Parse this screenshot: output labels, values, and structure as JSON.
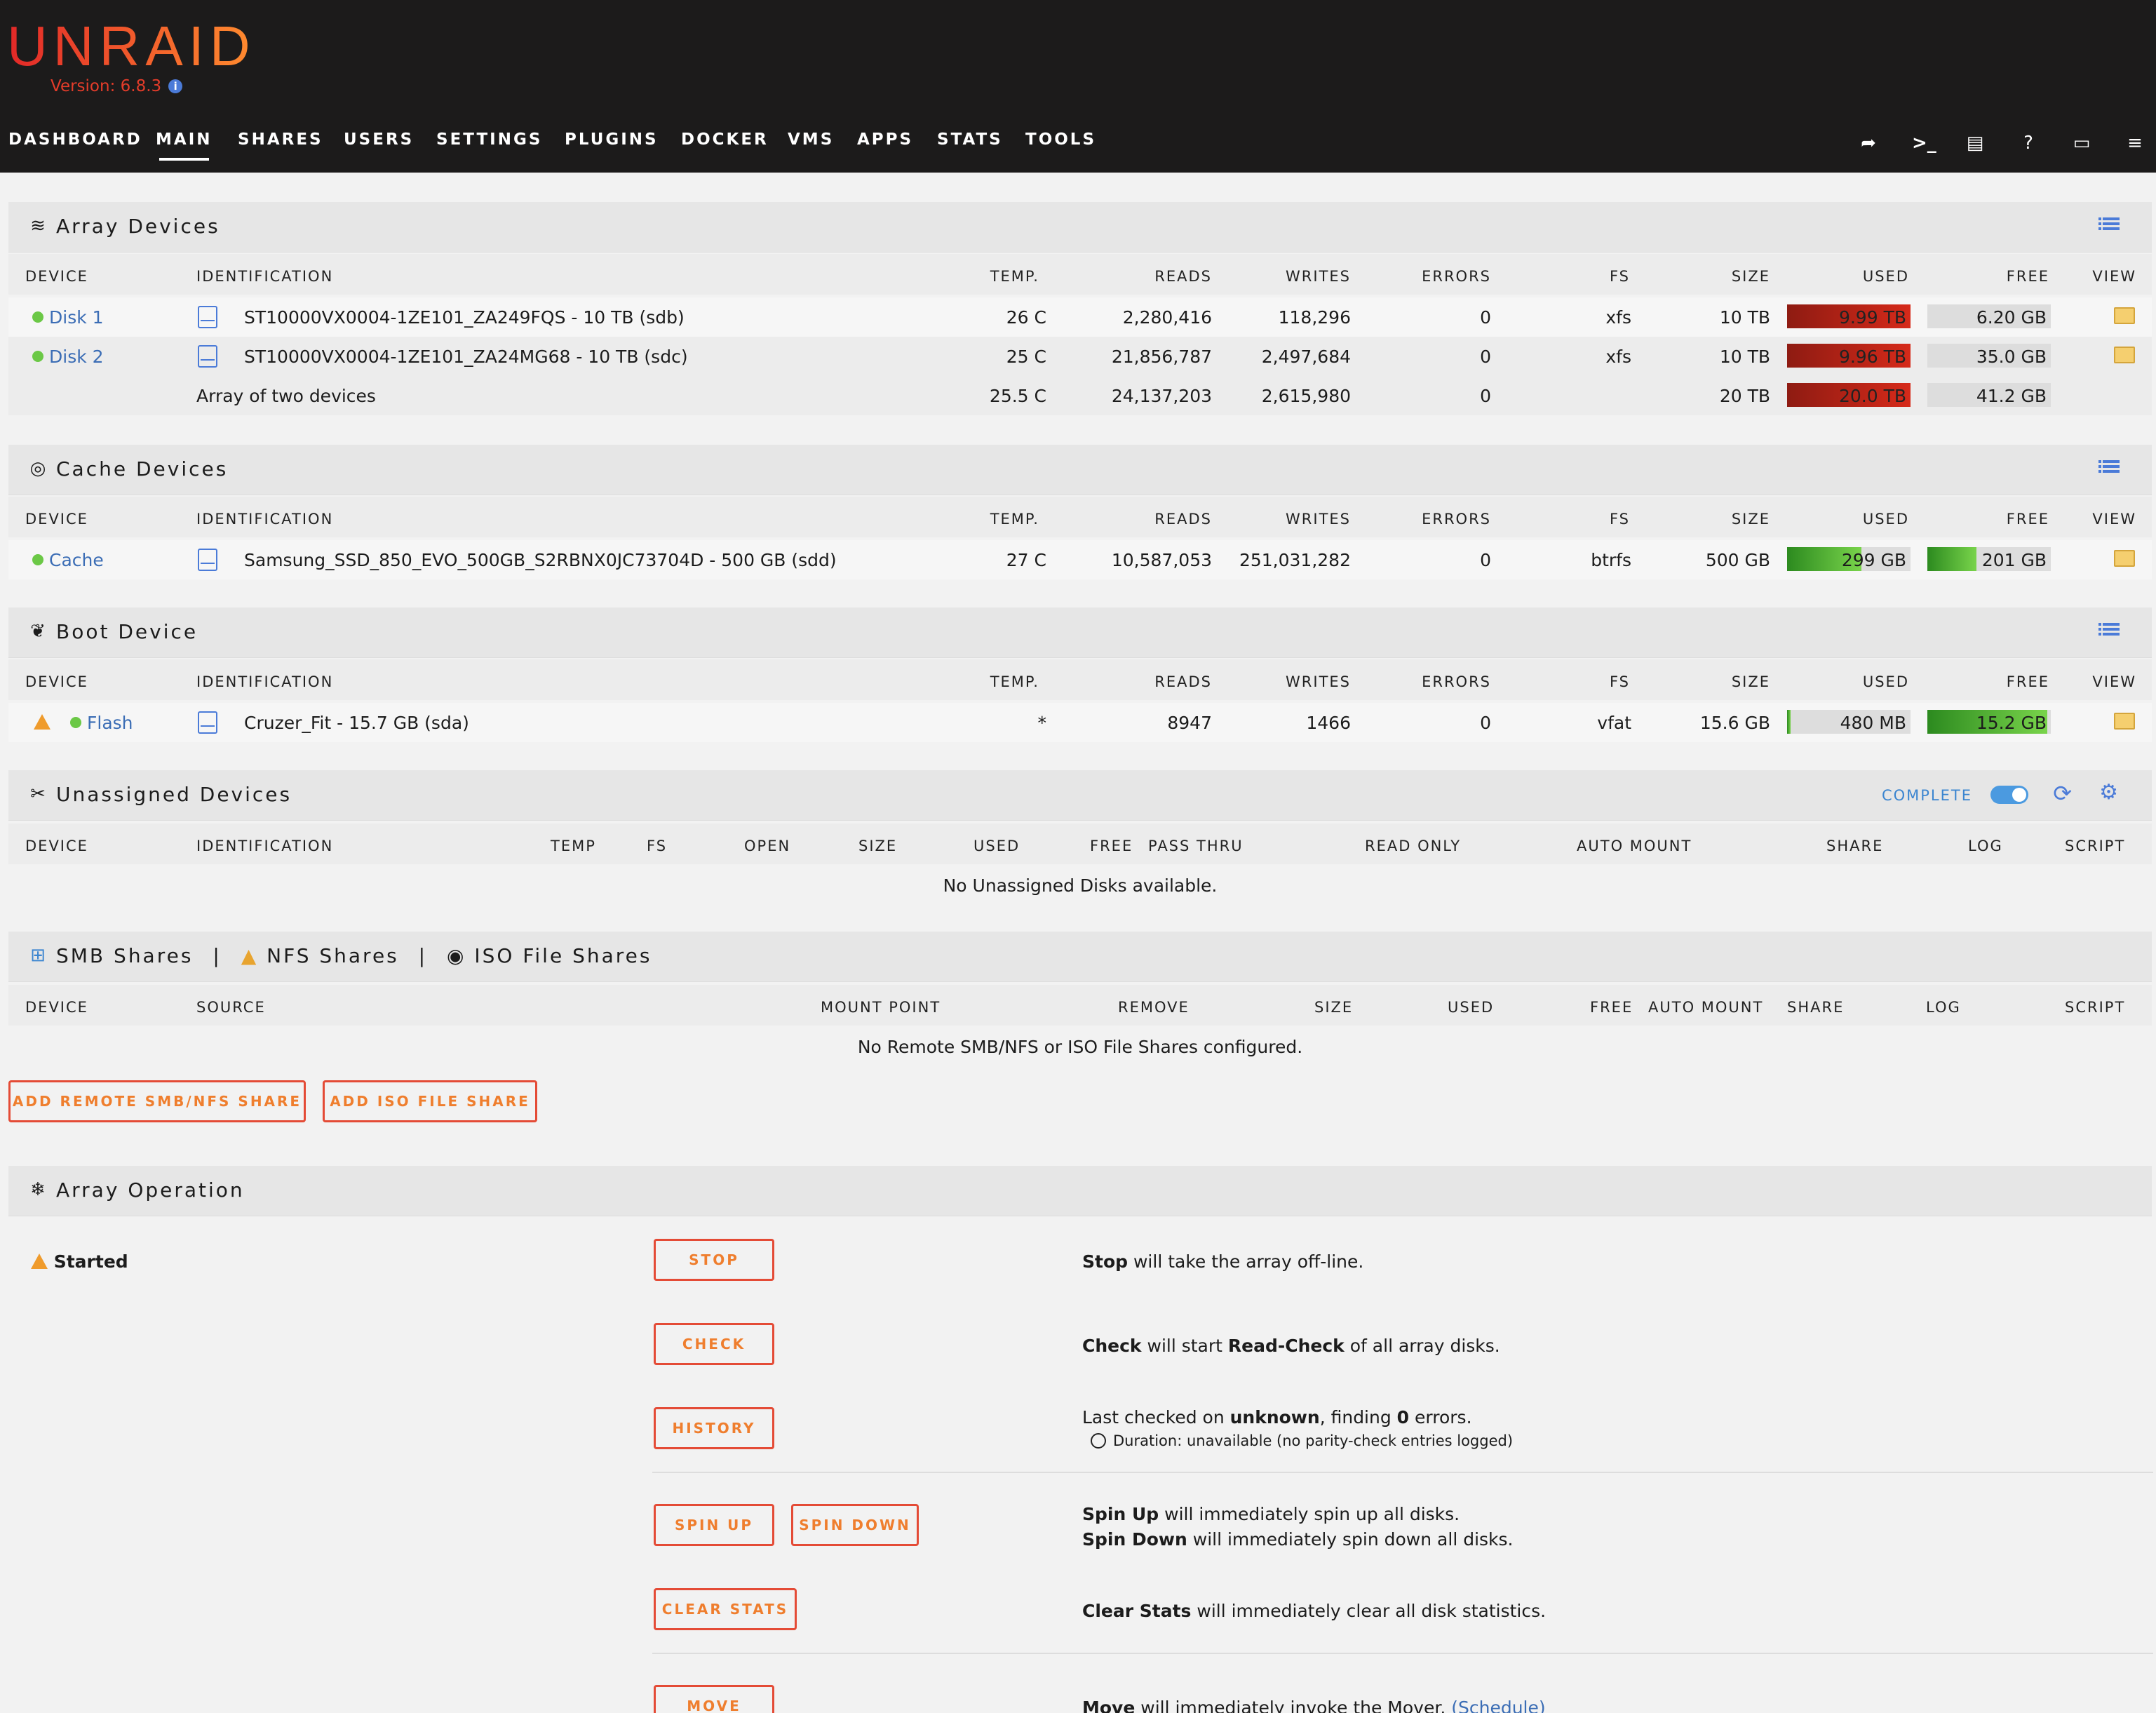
{
  "app": {
    "logo": "UNRAID",
    "version": "Version: 6.8.3"
  },
  "nav": [
    "DASHBOARD",
    "MAIN",
    "SHARES",
    "USERS",
    "SETTINGS",
    "PLUGINS",
    "DOCKER",
    "VMS",
    "APPS",
    "STATS",
    "TOOLS"
  ],
  "nav_active": "MAIN",
  "header_icons": [
    "logout-icon",
    "terminal-icon",
    "feedback-icon",
    "help-icon",
    "monitor-icon",
    "log-icon"
  ],
  "colors": {
    "header_bg": "#1c1b1b",
    "accent": "#ef7e2e",
    "link": "#3b6db5",
    "used_red": "#d62a1a",
    "free_green": "#6bc846"
  },
  "disk_columns": [
    "DEVICE",
    "IDENTIFICATION",
    "TEMP.",
    "READS",
    "WRITES",
    "ERRORS",
    "FS",
    "SIZE",
    "USED",
    "FREE",
    "VIEW"
  ],
  "array": {
    "title": "Array Devices",
    "rows": [
      {
        "device": "Disk 1",
        "id": "ST10000VX0004-1ZE101_ZA249FQS - 10 TB (sdb)",
        "temp": "26 C",
        "reads": "2,280,416",
        "writes": "118,296",
        "errors": "0",
        "fs": "xfs",
        "size": "10 TB",
        "used": "9.99 TB",
        "used_frac": 0.999,
        "free": "6.20 GB",
        "free_frac": 0.0
      },
      {
        "device": "Disk 2",
        "id": "ST10000VX0004-1ZE101_ZA24MG68 - 10 TB (sdc)",
        "temp": "25 C",
        "reads": "21,856,787",
        "writes": "2,497,684",
        "errors": "0",
        "fs": "xfs",
        "size": "10 TB",
        "used": "9.96 TB",
        "used_frac": 0.996,
        "free": "35.0 GB",
        "free_frac": 0.0
      }
    ],
    "summary": {
      "id": "Array of two devices",
      "temp": "25.5 C",
      "reads": "24,137,203",
      "writes": "2,615,980",
      "errors": "0",
      "size": "20 TB",
      "used": "20.0 TB",
      "used_frac": 0.998,
      "free": "41.2 GB",
      "free_frac": 0.0
    }
  },
  "cache": {
    "title": "Cache Devices",
    "rows": [
      {
        "device": "Cache",
        "id": "Samsung_SSD_850_EVO_500GB_S2RBNX0JC73704D - 500 GB (sdd)",
        "temp": "27 C",
        "reads": "10,587,053",
        "writes": "251,031,282",
        "errors": "0",
        "fs": "btrfs",
        "size": "500 GB",
        "used": "299 GB",
        "used_frac": 0.6,
        "free": "201 GB",
        "free_frac": 0.4
      }
    ]
  },
  "boot": {
    "title": "Boot Device",
    "rows": [
      {
        "device": "Flash",
        "id": "Cruzer_Fit - 15.7 GB (sda)",
        "temp": "*",
        "reads": "8947",
        "writes": "1466",
        "errors": "0",
        "fs": "vfat",
        "size": "15.6 GB",
        "used": "480 MB",
        "used_frac": 0.03,
        "free": "15.2 GB",
        "free_frac": 0.97
      }
    ]
  },
  "unassigned": {
    "title": "Unassigned Devices",
    "complete": "COMPLETE",
    "columns": [
      "DEVICE",
      "IDENTIFICATION",
      "TEMP",
      "FS",
      "OPEN",
      "SIZE",
      "USED",
      "FREE",
      "PASS THRU",
      "READ ONLY",
      "AUTO MOUNT",
      "SHARE",
      "LOG",
      "SCRIPT"
    ],
    "empty": "No Unassigned Disks available."
  },
  "remote": {
    "smb": "SMB Shares",
    "nfs": "NFS Shares",
    "iso": "ISO File Shares",
    "sep": "|",
    "columns": [
      "DEVICE",
      "SOURCE",
      "MOUNT POINT",
      "REMOVE",
      "SIZE",
      "USED",
      "FREE",
      "AUTO MOUNT",
      "SHARE",
      "LOG",
      "SCRIPT"
    ],
    "empty": "No Remote SMB/NFS or ISO File Shares configured.",
    "add_smb": "ADD REMOTE SMB/NFS SHARE",
    "add_iso": "ADD ISO FILE SHARE"
  },
  "operation": {
    "title": "Array Operation",
    "status": "Started",
    "stop": "STOP",
    "stop_b": "Stop",
    "stop_t": " will take the array off-line.",
    "check": "CHECK",
    "check_b": "Check",
    "check_t1": " will start ",
    "check_b2": "Read-Check",
    "check_t2": " of all array disks.",
    "history": "HISTORY",
    "hist_t1": "Last checked on ",
    "hist_b1": "unknown",
    "hist_t2": ", finding ",
    "hist_b2": "0",
    "hist_t3": " errors.",
    "duration": "Duration: unavailable (no parity-check entries logged)",
    "spinup": "SPIN UP",
    "spindown": "SPIN DOWN",
    "spinup_b": "Spin Up",
    "spinup_t": " will immediately spin up all disks.",
    "spindown_b": "Spin Down",
    "spindown_t": " will immediately spin down all disks.",
    "clear": "CLEAR STATS",
    "clear_b": "Clear Stats",
    "clear_t": " will immediately clear all disk statistics.",
    "move": "MOVE",
    "move_b": "Move",
    "move_t": " will immediately invoke the Mover.",
    "schedule": "(Schedule)"
  }
}
